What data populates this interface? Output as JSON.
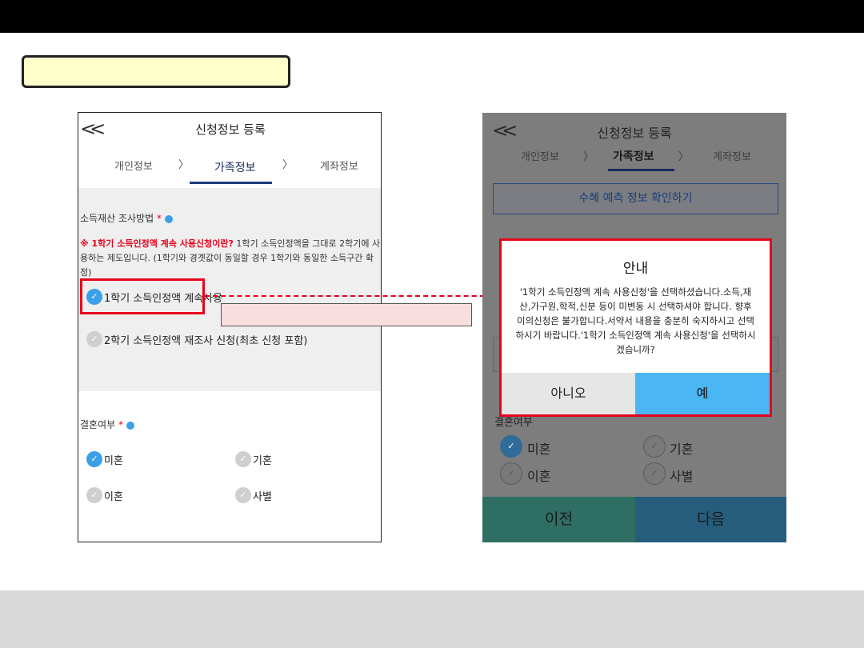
{
  "colors": {
    "accent_blue": "#3aa0e8",
    "highlight_red": "#e8001c",
    "callout_yellow": "#ffffcc",
    "dialog_yes": "#4ab6f3"
  },
  "left_phone": {
    "back_icon": "double-chevron-left-icon",
    "title": "신청정보 등록",
    "steps": [
      "개인정보",
      "가족정보",
      "계좌정보"
    ],
    "step_separator": "〉",
    "section_label": "소득재산 조사방법",
    "required_mark": "*",
    "info_icon": "info-icon",
    "note_red": "※ 1학기 소득인정액 계속 사용신청이란?",
    "note_text": " 1학기 소득인정액을 그대로 2학기에 사용하는 제도입니다. (1학기와 경곗값이 동일할 경우 1학기와 동일한 소득구간 확정)",
    "option_1": "1학기 소득인정액 계속사용",
    "option_2": "2학기 소득인정액 재조사 신청(최초 신청 포함)",
    "marriage_label": "결혼여부",
    "marriage_options": [
      "미혼",
      "기혼",
      "이혼",
      "사별"
    ]
  },
  "right_phone": {
    "back_icon": "double-chevron-left-icon",
    "title": "신청정보 등록",
    "steps": [
      "개인정보",
      "가족정보",
      "계좌정보"
    ],
    "step_separator": "〉",
    "info_button": "수혜 예측 정보 확인하기",
    "marriage_label": "결혼여부",
    "marriage_options": [
      "미혼",
      "기혼",
      "이혼",
      "사별"
    ],
    "prev_button": "이전",
    "next_button": "다음"
  },
  "dialog": {
    "title": "안내",
    "body": "'1학기 소득인정액 계속 사용신청'을 선택하셨습니다.소득,재산,가구원,학적,신분 등이 미변동 시 선택하셔야 합니다. 향후 이의신청은 불가합니다.서약서 내용을 충분히 숙지하시고 선택하시기 바랍니다.'1학기 소득인정액 계속 사용신청'을 선택하시겠습니까?",
    "no_button": "아니오",
    "yes_button": "예"
  }
}
